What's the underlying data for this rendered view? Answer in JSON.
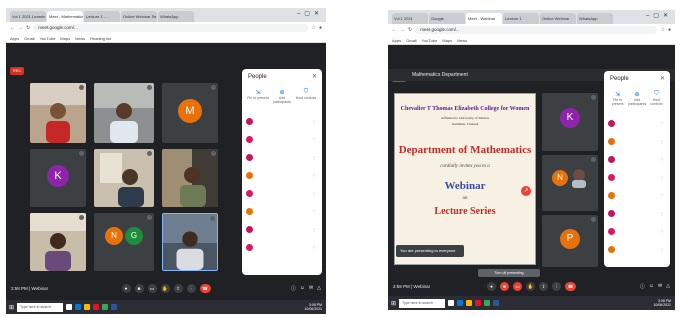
{
  "left_window": {
    "tabs": [
      "Vol 1 2021 Learnin",
      "Meet - Mathematics",
      "Lecture 1 - ...",
      "Online Webinar Se",
      "WhatsApp"
    ],
    "url": "meet.google.com/...",
    "bookmarks": [
      "Apps",
      "Gmail",
      "YouTube",
      "Maps",
      "News",
      "Reading list"
    ],
    "rec": "REC",
    "tiles": [
      {
        "name": "",
        "kind": "photo"
      },
      {
        "name": "",
        "kind": "photo"
      },
      {
        "name": "",
        "kind": "avatar",
        "letter": "M",
        "color": "#e8710a"
      },
      {
        "name": "",
        "kind": "avatar",
        "letter": "K",
        "color": "#8e24aa"
      },
      {
        "name": "",
        "kind": "photo"
      },
      {
        "name": "",
        "kind": "photo"
      },
      {
        "name": "",
        "kind": "photo"
      },
      {
        "name": "",
        "kind": "avatar",
        "letter": "NG",
        "color": "#e8710a"
      },
      {
        "name": "",
        "kind": "photo"
      }
    ],
    "people_title": "People",
    "people_tools": [
      "Pin to present",
      "Add participants",
      "Host controls"
    ],
    "time": "2:58 PM | Webinar",
    "tray": [
      "3:08 PM",
      "10/06/2021"
    ],
    "search_placeholder": "Type here to search"
  },
  "right_window": {
    "tabs": [
      "Vol 1 2021",
      "Google",
      "Meet - Webinar",
      "Lecture 1",
      "Online Webinar",
      "WhatsApp"
    ],
    "url": "meet.google.com/...",
    "bookmarks": [
      "Apps",
      "Gmail",
      "YouTube",
      "Maps",
      "News"
    ],
    "rec": "REC",
    "presenter": "Mathematics Department",
    "slide": {
      "college": "Chevalier T Thomas Elizabeth College for Women",
      "affiliation": "Affiliated to University of Madras",
      "address": "Sembium, Chennai",
      "department": "Department of Mathematics",
      "invite": "cordially invites you to a",
      "event": "Webinar",
      "series": "on",
      "series2": "Lecture Series"
    },
    "toast": "You are presenting to everyone",
    "tooltip": "Turn off presenting",
    "side_tiles": [
      {
        "letter": "K",
        "color": "#8e24aa"
      },
      {
        "letter": "N",
        "color": "#e8710a"
      },
      {
        "letter": "P",
        "color": "#e8710a"
      }
    ],
    "people_title": "People",
    "people_tools": [
      "Pin to present",
      "Add participants",
      "Host controls"
    ],
    "time": "2:59 PM | Webinar",
    "tray": [
      "3:08 PM",
      "10/06/2021"
    ],
    "search_placeholder": "Type here to search"
  }
}
